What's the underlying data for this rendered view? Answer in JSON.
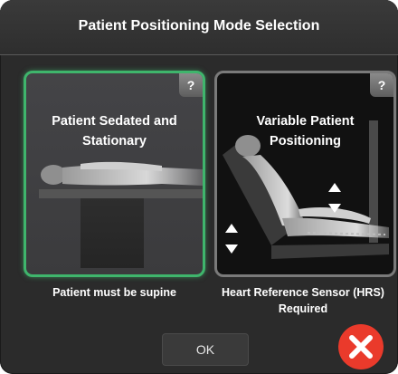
{
  "dialog": {
    "title": "Patient Positioning Mode Selection"
  },
  "options": [
    {
      "title": "Patient Sedated and Stationary",
      "help": "?",
      "caption": "Patient must be supine",
      "selected": true
    },
    {
      "title": "Variable Patient Positioning",
      "help": "?",
      "caption": "Heart Reference Sensor (HRS) Required",
      "selected": false
    }
  ],
  "footer": {
    "ok_label": "OK"
  },
  "colors": {
    "selected_border": "#3fb56c",
    "close_button": "#ea3a2b",
    "background": "#2b2b2b"
  },
  "icons": {
    "help": "question-mark-icon",
    "close": "close-x-icon",
    "arrow_up": "arrow-up-icon",
    "arrow_down": "arrow-down-icon"
  }
}
